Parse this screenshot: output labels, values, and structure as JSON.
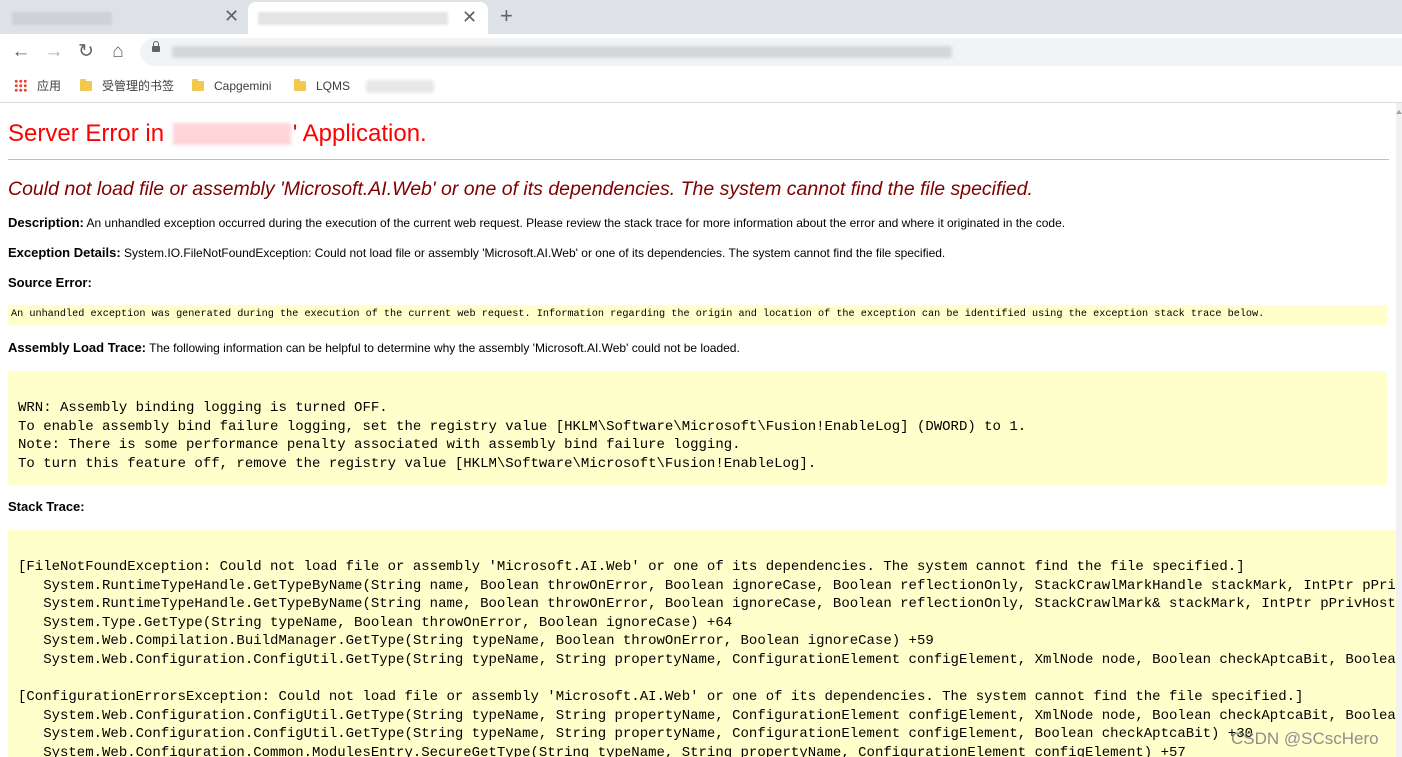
{
  "browser": {
    "tabs": [
      {
        "close_glyph": "✕"
      },
      {
        "close_glyph": "✕"
      }
    ],
    "new_tab_glyph": "+",
    "nav": {
      "back": "←",
      "forward": "→",
      "reload": "↻",
      "home": "⌂"
    },
    "bookmarks": [
      {
        "label": "应用",
        "icon": "apps-grid-icon"
      },
      {
        "label": "受管理的书签",
        "icon": "folder-icon"
      },
      {
        "label": "Capgemini",
        "icon": "folder-icon"
      },
      {
        "label": "LQMS",
        "icon": "folder-icon"
      }
    ]
  },
  "page": {
    "heading_prefix": "Server Error in",
    "heading_suffix": "' Application.",
    "error_title": "Could not load file or assembly 'Microsoft.AI.Web' or one of its dependencies. The system cannot find the file specified.",
    "description": {
      "label": "Description:",
      "text": "An unhandled exception occurred during the execution of the current web request. Please review the stack trace for more information about the error and where it originated in the code."
    },
    "exception_details": {
      "label": "Exception Details:",
      "text": "System.IO.FileNotFoundException: Could not load file or assembly 'Microsoft.AI.Web' or one of its dependencies. The system cannot find the file specified."
    },
    "source_error": {
      "label": "Source Error:",
      "text": "An unhandled exception was generated during the execution of the current web request. Information regarding the origin and location of the exception can be identified using the exception stack trace below."
    },
    "assembly_load_trace": {
      "label": "Assembly Load Trace:",
      "text": "The following information can be helpful to determine why the assembly 'Microsoft.AI.Web' could not be loaded.",
      "lines": [
        "WRN: Assembly binding logging is turned OFF.",
        "To enable assembly bind failure logging, set the registry value [HKLM\\Software\\Microsoft\\Fusion!EnableLog] (DWORD) to 1.",
        "Note: There is some performance penalty associated with assembly bind failure logging.",
        "To turn this feature off, remove the registry value [HKLM\\Software\\Microsoft\\Fusion!EnableLog]."
      ]
    },
    "stack_trace": {
      "label": "Stack Trace:",
      "lines": [
        "[FileNotFoundException: Could not load file or assembly 'Microsoft.AI.Web' or one of its dependencies. The system cannot find the file specified.]",
        "   System.RuntimeTypeHandle.GetTypeByName(String name, Boolean throwOnError, Boolean ignoreCase, Boolean reflectionOnly, StackCrawlMarkHandle stackMark, IntPtr pPrivHostBi",
        "   System.RuntimeTypeHandle.GetTypeByName(String name, Boolean throwOnError, Boolean ignoreCase, Boolean reflectionOnly, StackCrawlMark& stackMark, IntPtr pPrivHostBinder,",
        "   System.Type.GetType(String typeName, Boolean throwOnError, Boolean ignoreCase) +64",
        "   System.Web.Compilation.BuildManager.GetType(String typeName, Boolean throwOnError, Boolean ignoreCase) +59",
        "   System.Web.Configuration.ConfigUtil.GetType(String typeName, String propertyName, ConfigurationElement configElement, XmlNode node, Boolean checkAptcaBit, Boolean ignor",
        "",
        "[ConfigurationErrorsException: Could not load file or assembly 'Microsoft.AI.Web' or one of its dependencies. The system cannot find the file specified.]",
        "   System.Web.Configuration.ConfigUtil.GetType(String typeName, String propertyName, ConfigurationElement configElement, XmlNode node, Boolean checkAptcaBit, Boolean ignor",
        "   System.Web.Configuration.ConfigUtil.GetType(String typeName, String propertyName, ConfigurationElement configElement, Boolean checkAptcaBit) +30",
        "   System.Web.Configuration.Common.ModulesEntry.SecureGetType(String typeName, String propertyName, ConfigurationElement configElement) +57"
      ]
    }
  },
  "watermark": "CSDN @SCscHero"
}
